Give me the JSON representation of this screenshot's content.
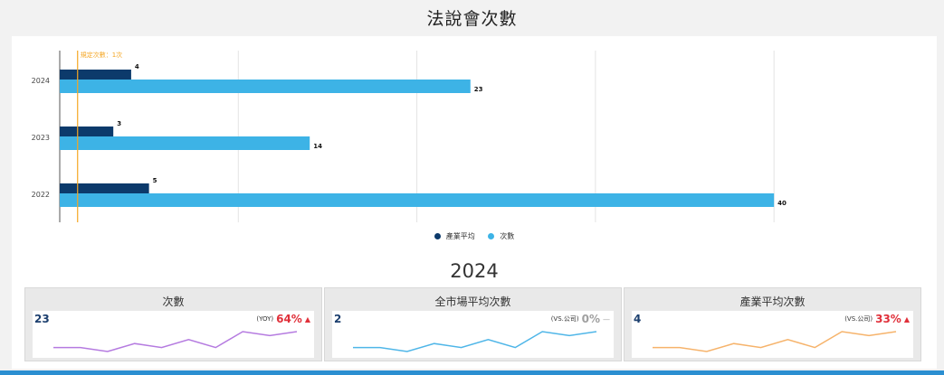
{
  "page": {
    "title": "法說會次數"
  },
  "chart_data": {
    "type": "bar",
    "orientation": "horizontal",
    "categories": [
      "2024",
      "2023",
      "2022"
    ],
    "series": [
      {
        "name": "產業平均",
        "values": [
          4,
          3,
          5
        ],
        "color": "#0c3a6b"
      },
      {
        "name": "次數",
        "values": [
          23,
          14,
          40
        ],
        "color": "#3db3e6"
      }
    ],
    "xlim": [
      0,
      48
    ],
    "grid": true,
    "reference_line": {
      "label": "規定次數：1次",
      "value": 1,
      "color": "#f5a623"
    },
    "legend_position": "bottom"
  },
  "summary": {
    "year": "2024",
    "cards": [
      {
        "title": "次數",
        "value": "23",
        "compare_label": "(YOY)",
        "pct": "64%",
        "trend": "up",
        "arrow": "▲",
        "pct_color": "#e0303a",
        "spark_color": "#b57be0",
        "spark": [
          3,
          3,
          2,
          4,
          3,
          5,
          3,
          7,
          6,
          7
        ]
      },
      {
        "title": "全市場平均次數",
        "value": "2",
        "compare_label": "(VS.公司)",
        "pct": "0%",
        "trend": "flat",
        "arrow": "—",
        "pct_color": "#a0a0a0",
        "spark_color": "#4fb6e8",
        "spark": [
          3,
          3,
          2,
          4,
          3,
          5,
          3,
          7,
          6,
          7
        ]
      },
      {
        "title": "產業平均次數",
        "value": "4",
        "compare_label": "(VS.公司)",
        "pct": "33%",
        "trend": "up",
        "arrow": "▲",
        "pct_color": "#e0303a",
        "spark_color": "#f6b36b",
        "spark": [
          3,
          3,
          2,
          4,
          3,
          5,
          3,
          7,
          6,
          7
        ]
      }
    ]
  }
}
